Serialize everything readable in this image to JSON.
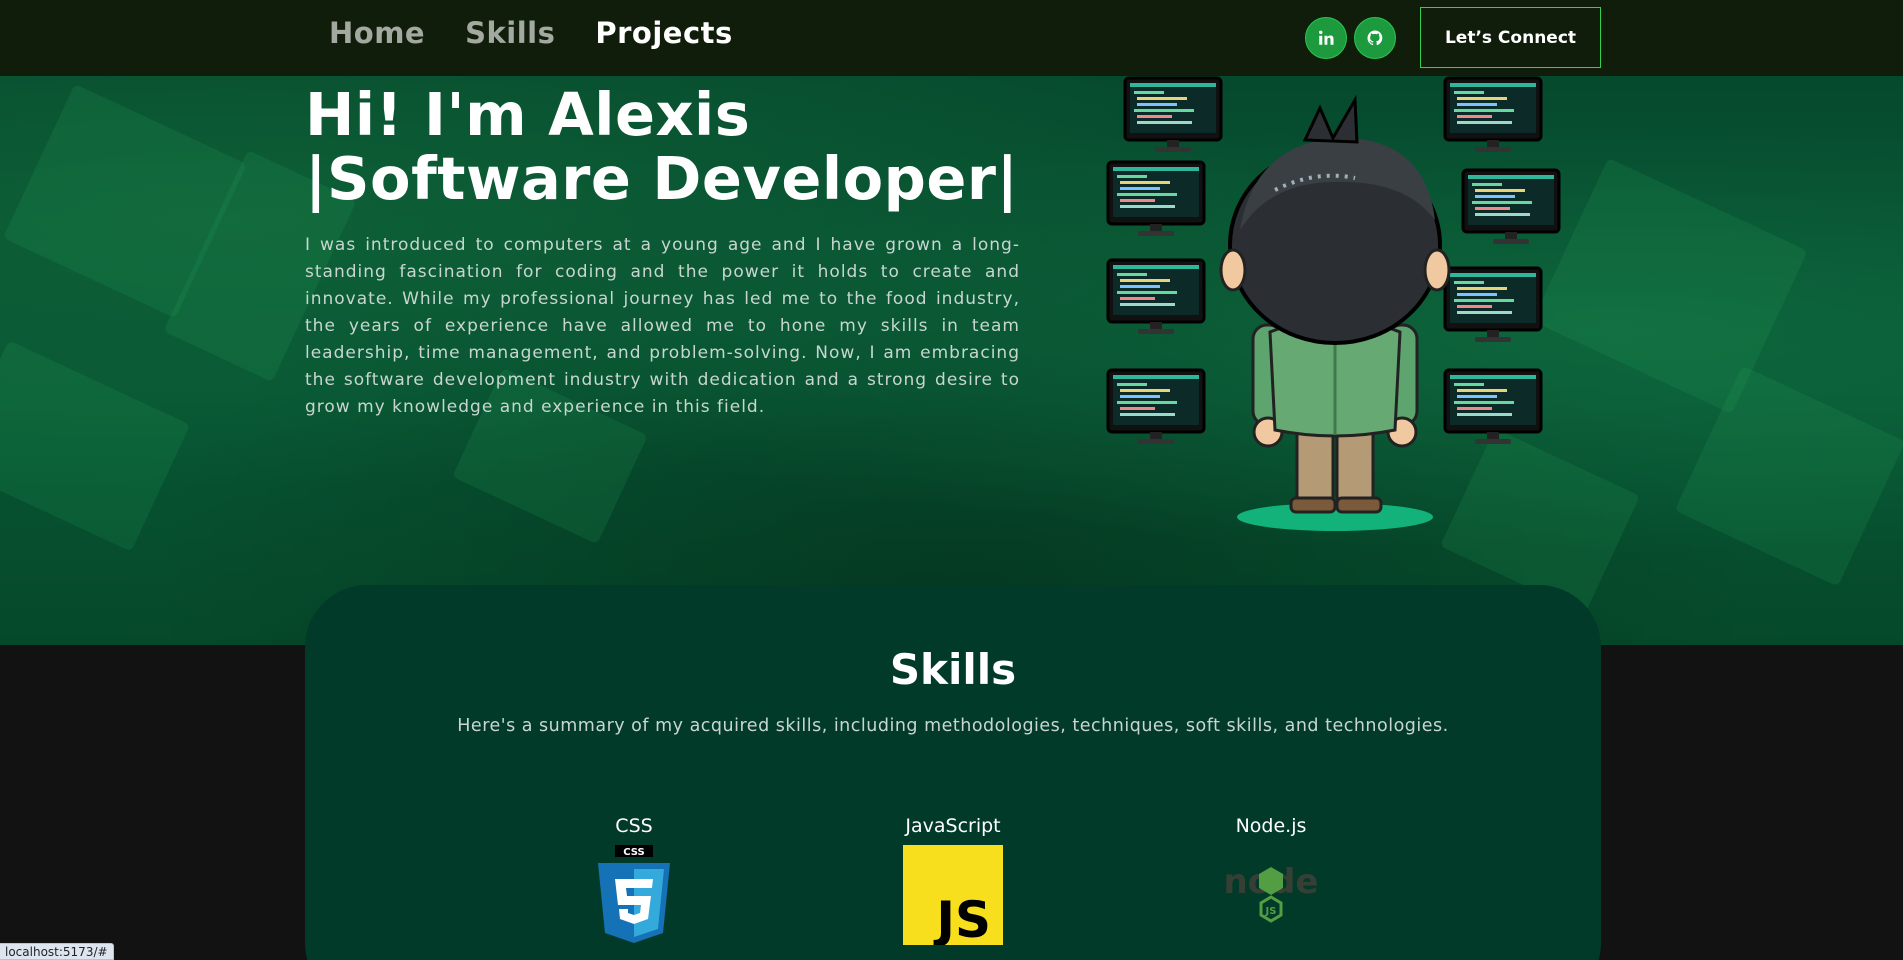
{
  "nav": {
    "links": [
      "Home",
      "Skills",
      "Projects"
    ],
    "connect_label": "Let’s Connect",
    "social_icons": [
      "linkedin-icon",
      "github-icon"
    ]
  },
  "hero": {
    "title_line1": "Hi! I'm Alexis",
    "title_line2": "|Software Developer|",
    "description": "I was introduced to computers at a young age and I have grown a long-standing fascination for coding and the power it holds to create and innovate. While my professional journey has led me to the food industry, the years of experience have allowed me to hone my skills in team leadership, time management, and problem-solving. Now, I am embracing the software development industry with dedication and a strong desire to grow my knowledge and experience in this field."
  },
  "skills": {
    "title": "Skills",
    "subtitle": "Here's a summary of my acquired skills, including methodologies, techniques, soft skills, and technologies.",
    "items": [
      {
        "name": "CSS",
        "icon": "css3-logo-icon"
      },
      {
        "name": "JavaScript",
        "icon": "javascript-logo-icon"
      },
      {
        "name": "Node.js",
        "icon": "nodejs-logo-icon"
      }
    ]
  },
  "status": {
    "url": "localhost:5173/#"
  },
  "colors": {
    "nav_bg": "#0f1d0a",
    "accent_green": "#1d9a3e",
    "connect_border": "#32d14d",
    "hero_bg": "#075634",
    "skills_card_bg": "#023a2a",
    "page_bg": "#121212"
  }
}
